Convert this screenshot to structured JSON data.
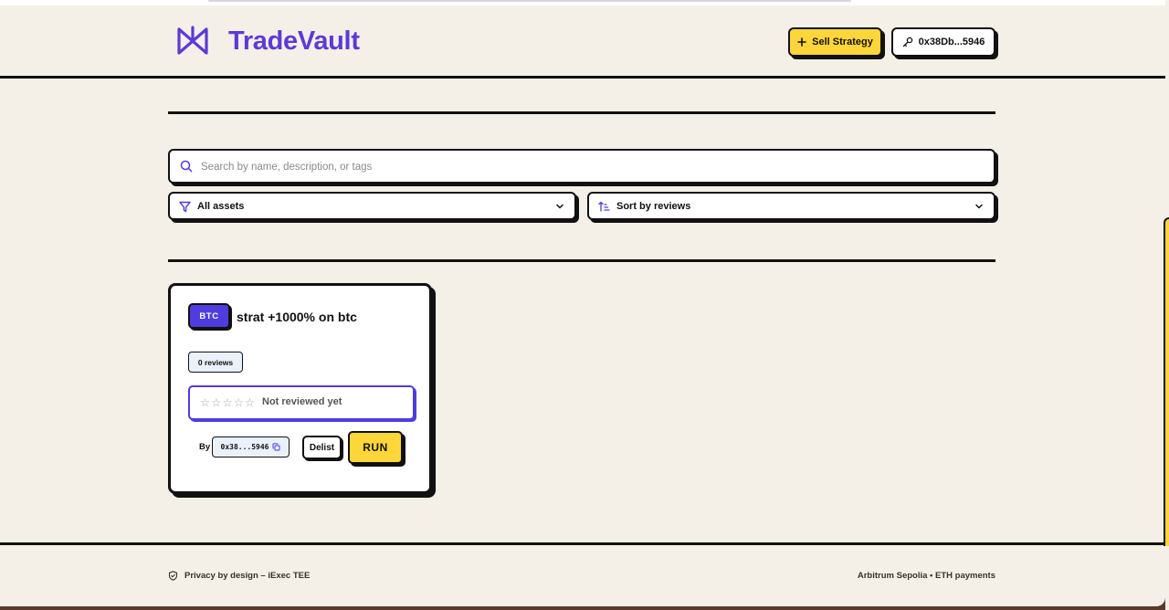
{
  "header": {
    "brand": "TradeVault",
    "sell_button_label": "Sell Strategy",
    "wallet_address": "0x38Db...5946"
  },
  "search": {
    "placeholder": "Search by name, description, or tags",
    "value": ""
  },
  "filters": {
    "asset_filter": "All assets",
    "sort": "Sort by reviews"
  },
  "strategies": [
    {
      "asset": "BTC",
      "title": "strat +1000% on btc",
      "reviews": "0 reviews",
      "rating": 0,
      "rating_text": "Not reviewed yet",
      "by_label": "By",
      "owner": "0x38...5946",
      "delist_label": "Delist",
      "run_label": "RUN"
    }
  ],
  "footer": {
    "left": "Privacy by design – iExec TEE",
    "right": "Arbitrum Sepolia • ETH payments"
  },
  "colors": {
    "accent": "#5b3bd6",
    "button_yellow": "#ffd63a",
    "badge_blue": "#4f3ddf",
    "background": "#f4f0e7"
  },
  "icons": {
    "logo": "bowtie-logo-icon",
    "sell": "plus-icon",
    "wallet": "key-icon",
    "search": "search-icon",
    "filter": "filter-icon",
    "sort": "sort-ascending-icon",
    "chevron": "chevron-down-icon",
    "copy": "copy-icon",
    "shield": "shield-check-icon"
  }
}
